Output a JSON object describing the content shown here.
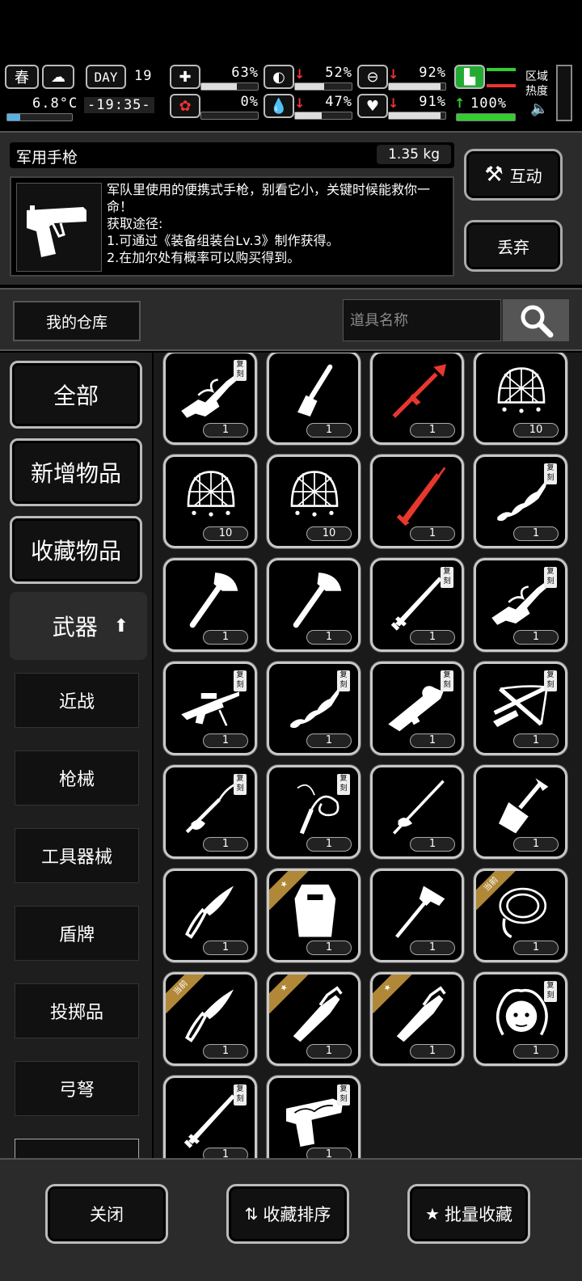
{
  "status": {
    "season": "春",
    "temperature": "6.8°C",
    "day_label": "DAY",
    "day": "19",
    "time": "-19:35-",
    "stats": [
      {
        "name": "health",
        "value": "63%",
        "fill": 0.63
      },
      {
        "name": "hunger",
        "value": "52%",
        "fill": 0.52,
        "trend": "down"
      },
      {
        "name": "stamina",
        "value": "92%",
        "fill": 0.92,
        "trend": "down"
      },
      {
        "name": "infection",
        "value": "0%",
        "fill": 0.0
      },
      {
        "name": "thirst",
        "value": "47%",
        "fill": 0.47,
        "trend": "down"
      },
      {
        "name": "mood",
        "value": "91%",
        "fill": 0.91,
        "trend": "down"
      }
    ],
    "speed": {
      "value": "100%",
      "fill": 1.0,
      "trend": "up"
    },
    "area_heat_label_1": "区域",
    "area_heat_label_2": "热度"
  },
  "item": {
    "name": "军用手枪",
    "weight": "1.35 kg",
    "description": "军队里使用的便携式手枪，别看它小，关键时候能救你一命！\n获取途径:\n1.可通过《装备组装台Lv.3》制作获得。\n2.在加尔处有概率可以购买得到。",
    "interact_label": "互动",
    "discard_label": "丢弃"
  },
  "storage": {
    "title": "我的仓库",
    "search_placeholder": "道具名称"
  },
  "categories": {
    "main": [
      "全部",
      "新增物品",
      "收藏物品"
    ],
    "selected": "武器",
    "sub": [
      "近战",
      "枪械",
      "工具器械",
      "盾牌",
      "投掷品",
      "弓弩"
    ]
  },
  "tags": {
    "replica": "复刻",
    "current": "当前"
  },
  "items": [
    {
      "icon": "ornate-rifle-icon",
      "count": "1",
      "replica": true,
      "color": "#ffffff"
    },
    {
      "icon": "spatula-icon",
      "count": "1",
      "color": "#ffffff"
    },
    {
      "icon": "red-spear-icon",
      "count": "1",
      "color": "#e8372d"
    },
    {
      "icon": "net-icon",
      "count": "10",
      "color": "#ffffff"
    },
    {
      "icon": "net-icon",
      "count": "10",
      "color": "#ffffff"
    },
    {
      "icon": "net-icon",
      "count": "10",
      "color": "#ffffff"
    },
    {
      "icon": "red-sword-icon",
      "count": "1",
      "color": "#e8372d"
    },
    {
      "icon": "chain-blade-icon",
      "count": "1",
      "replica": true,
      "color": "#ffffff"
    },
    {
      "icon": "axe-icon",
      "count": "1",
      "color": "#ffffff"
    },
    {
      "icon": "axe-icon",
      "count": "1",
      "color": "#ffffff"
    },
    {
      "icon": "katana-icon",
      "count": "1",
      "replica": true,
      "color": "#ffffff"
    },
    {
      "icon": "ornate-rifle-icon",
      "count": "1",
      "replica": true,
      "color": "#ffffff"
    },
    {
      "icon": "sniper-rifle-icon",
      "count": "1",
      "replica": true,
      "color": "#ffffff"
    },
    {
      "icon": "chain-blade-icon",
      "count": "1",
      "replica": true,
      "color": "#ffffff"
    },
    {
      "icon": "rocket-launcher-icon",
      "count": "1",
      "replica": true,
      "color": "#ffffff"
    },
    {
      "icon": "crossbow-icon",
      "count": "1",
      "replica": true,
      "color": "#ffffff"
    },
    {
      "icon": "staff-icon",
      "count": "1",
      "replica": true,
      "color": "#ffffff"
    },
    {
      "icon": "whip-icon",
      "count": "1",
      "replica": true,
      "color": "#ffffff"
    },
    {
      "icon": "spear-icon",
      "count": "1",
      "color": "#ffffff"
    },
    {
      "icon": "shovel-icon",
      "count": "1",
      "color": "#ffffff"
    },
    {
      "icon": "knife-icon",
      "count": "1",
      "color": "#ffffff"
    },
    {
      "icon": "riot-shield-icon",
      "count": "1",
      "star": true,
      "color": "#ffffff"
    },
    {
      "icon": "hammer-icon",
      "count": "1",
      "color": "#ffffff"
    },
    {
      "icon": "rope-icon",
      "count": "1",
      "current": true,
      "color": "#ffffff"
    },
    {
      "icon": "knife-icon",
      "count": "1",
      "current": true,
      "color": "#ffffff"
    },
    {
      "icon": "machete-icon",
      "count": "1",
      "star": true,
      "color": "#ffffff"
    },
    {
      "icon": "machete-icon",
      "count": "1",
      "star": true,
      "color": "#ffffff"
    },
    {
      "icon": "medusa-icon",
      "count": "1",
      "replica": true,
      "color": "#ffffff"
    },
    {
      "icon": "katana-icon",
      "count": "1",
      "replica": true,
      "color": "#ffffff"
    },
    {
      "icon": "ornate-pistol-icon",
      "count": "1",
      "replica": true,
      "color": "#ffffff"
    }
  ],
  "bottom": {
    "close_label": "关闭",
    "sort_label": "收藏排序",
    "batch_label": "批量收藏"
  }
}
